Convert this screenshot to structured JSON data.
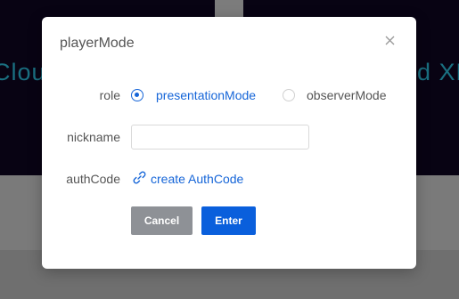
{
  "background": {
    "left_text": "Cloud",
    "right_text": "ud XR"
  },
  "dialog": {
    "title": "playerMode",
    "close_icon": "close-icon",
    "role": {
      "label": "role",
      "options": [
        {
          "label": "presentationMode",
          "checked": true
        },
        {
          "label": "observerMode",
          "checked": false
        }
      ]
    },
    "nickname": {
      "label": "nickname",
      "value": "",
      "placeholder": ""
    },
    "authcode": {
      "label": "authCode",
      "link_label": "create AuthCode",
      "link_icon": "link-icon"
    },
    "buttons": {
      "cancel": "Cancel",
      "enter": "Enter"
    }
  },
  "colors": {
    "accent": "#1565d8",
    "enter_button": "#0a5fdc",
    "cancel_button": "#8e9196",
    "backdrop_top": "#080313"
  }
}
